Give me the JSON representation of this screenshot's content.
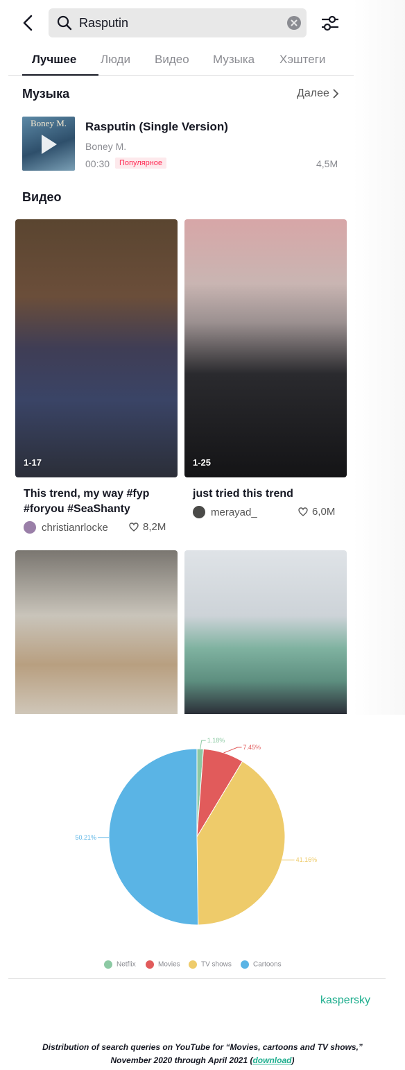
{
  "search": {
    "query": "Rasputin"
  },
  "tabs": [
    {
      "label": "Лучшее",
      "active": true
    },
    {
      "label": "Люди"
    },
    {
      "label": "Видео"
    },
    {
      "label": "Музыка"
    },
    {
      "label": "Хэштеги"
    }
  ],
  "music": {
    "title": "Музыка",
    "more": "Далее",
    "cover_text": "Boney M.",
    "track": "Rasputin (Single Version)",
    "artist": "Boney M.",
    "duration": "00:30",
    "badge": "Популярное",
    "plays": "4,5M"
  },
  "videos": {
    "title": "Видео",
    "items": [
      {
        "duration": "1-17",
        "caption_line1": "This trend, my way #fyp",
        "caption_line2": "#foryou #SeaShanty",
        "author": "christianrlocke",
        "likes": "8,2M"
      },
      {
        "duration": "1-25",
        "caption_line1": "just tried this trend",
        "author": "merayad_",
        "likes": "6,0M"
      }
    ]
  },
  "chart_data": {
    "type": "pie",
    "slices": [
      {
        "label": "Netflix",
        "value": 1.18,
        "display": "1.18%",
        "color": "#8cc9a3"
      },
      {
        "label": "Movies",
        "value": 7.45,
        "display": "7.45%",
        "color": "#e15b5b"
      },
      {
        "label": "TV shows",
        "value": 41.16,
        "display": "41.16%",
        "color": "#eecb6a"
      },
      {
        "label": "Cartoons",
        "value": 50.21,
        "display": "50.21%",
        "color": "#5ab4e5"
      }
    ],
    "legend_position": "bottom"
  },
  "brand": "kaspersky",
  "footer": {
    "line1": "Distribution of search queries on YouTube for “Movies, cartoons and TV shows,”",
    "line2_prefix": "November 2020 through April 2021 (",
    "link": "download",
    "line2_suffix": ")"
  }
}
